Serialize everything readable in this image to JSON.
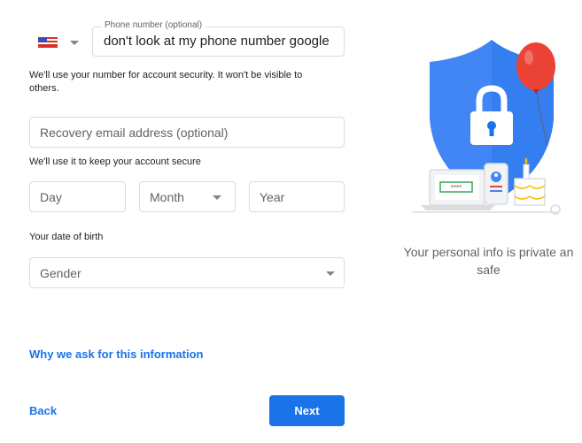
{
  "phone": {
    "label": "Phone number (optional)",
    "value": "don't look at my phone number google",
    "help": "We'll use your number for account security. It won't be visible to others."
  },
  "recovery_email": {
    "placeholder": "Recovery email address (optional)",
    "help": "We'll use it to keep your account secure"
  },
  "dob": {
    "day_placeholder": "Day",
    "month_placeholder": "Month",
    "year_placeholder": "Year",
    "help": "Your date of birth"
  },
  "gender": {
    "placeholder": "Gender"
  },
  "links": {
    "why": "Why we ask for this information",
    "back": "Back"
  },
  "buttons": {
    "next": "Next"
  },
  "illustration": {
    "caption": "Your personal info is private an safe",
    "password_mask": "****"
  },
  "colors": {
    "accent": "#1a73e8",
    "shield": "#4285f4",
    "balloon": "#ea4335"
  }
}
